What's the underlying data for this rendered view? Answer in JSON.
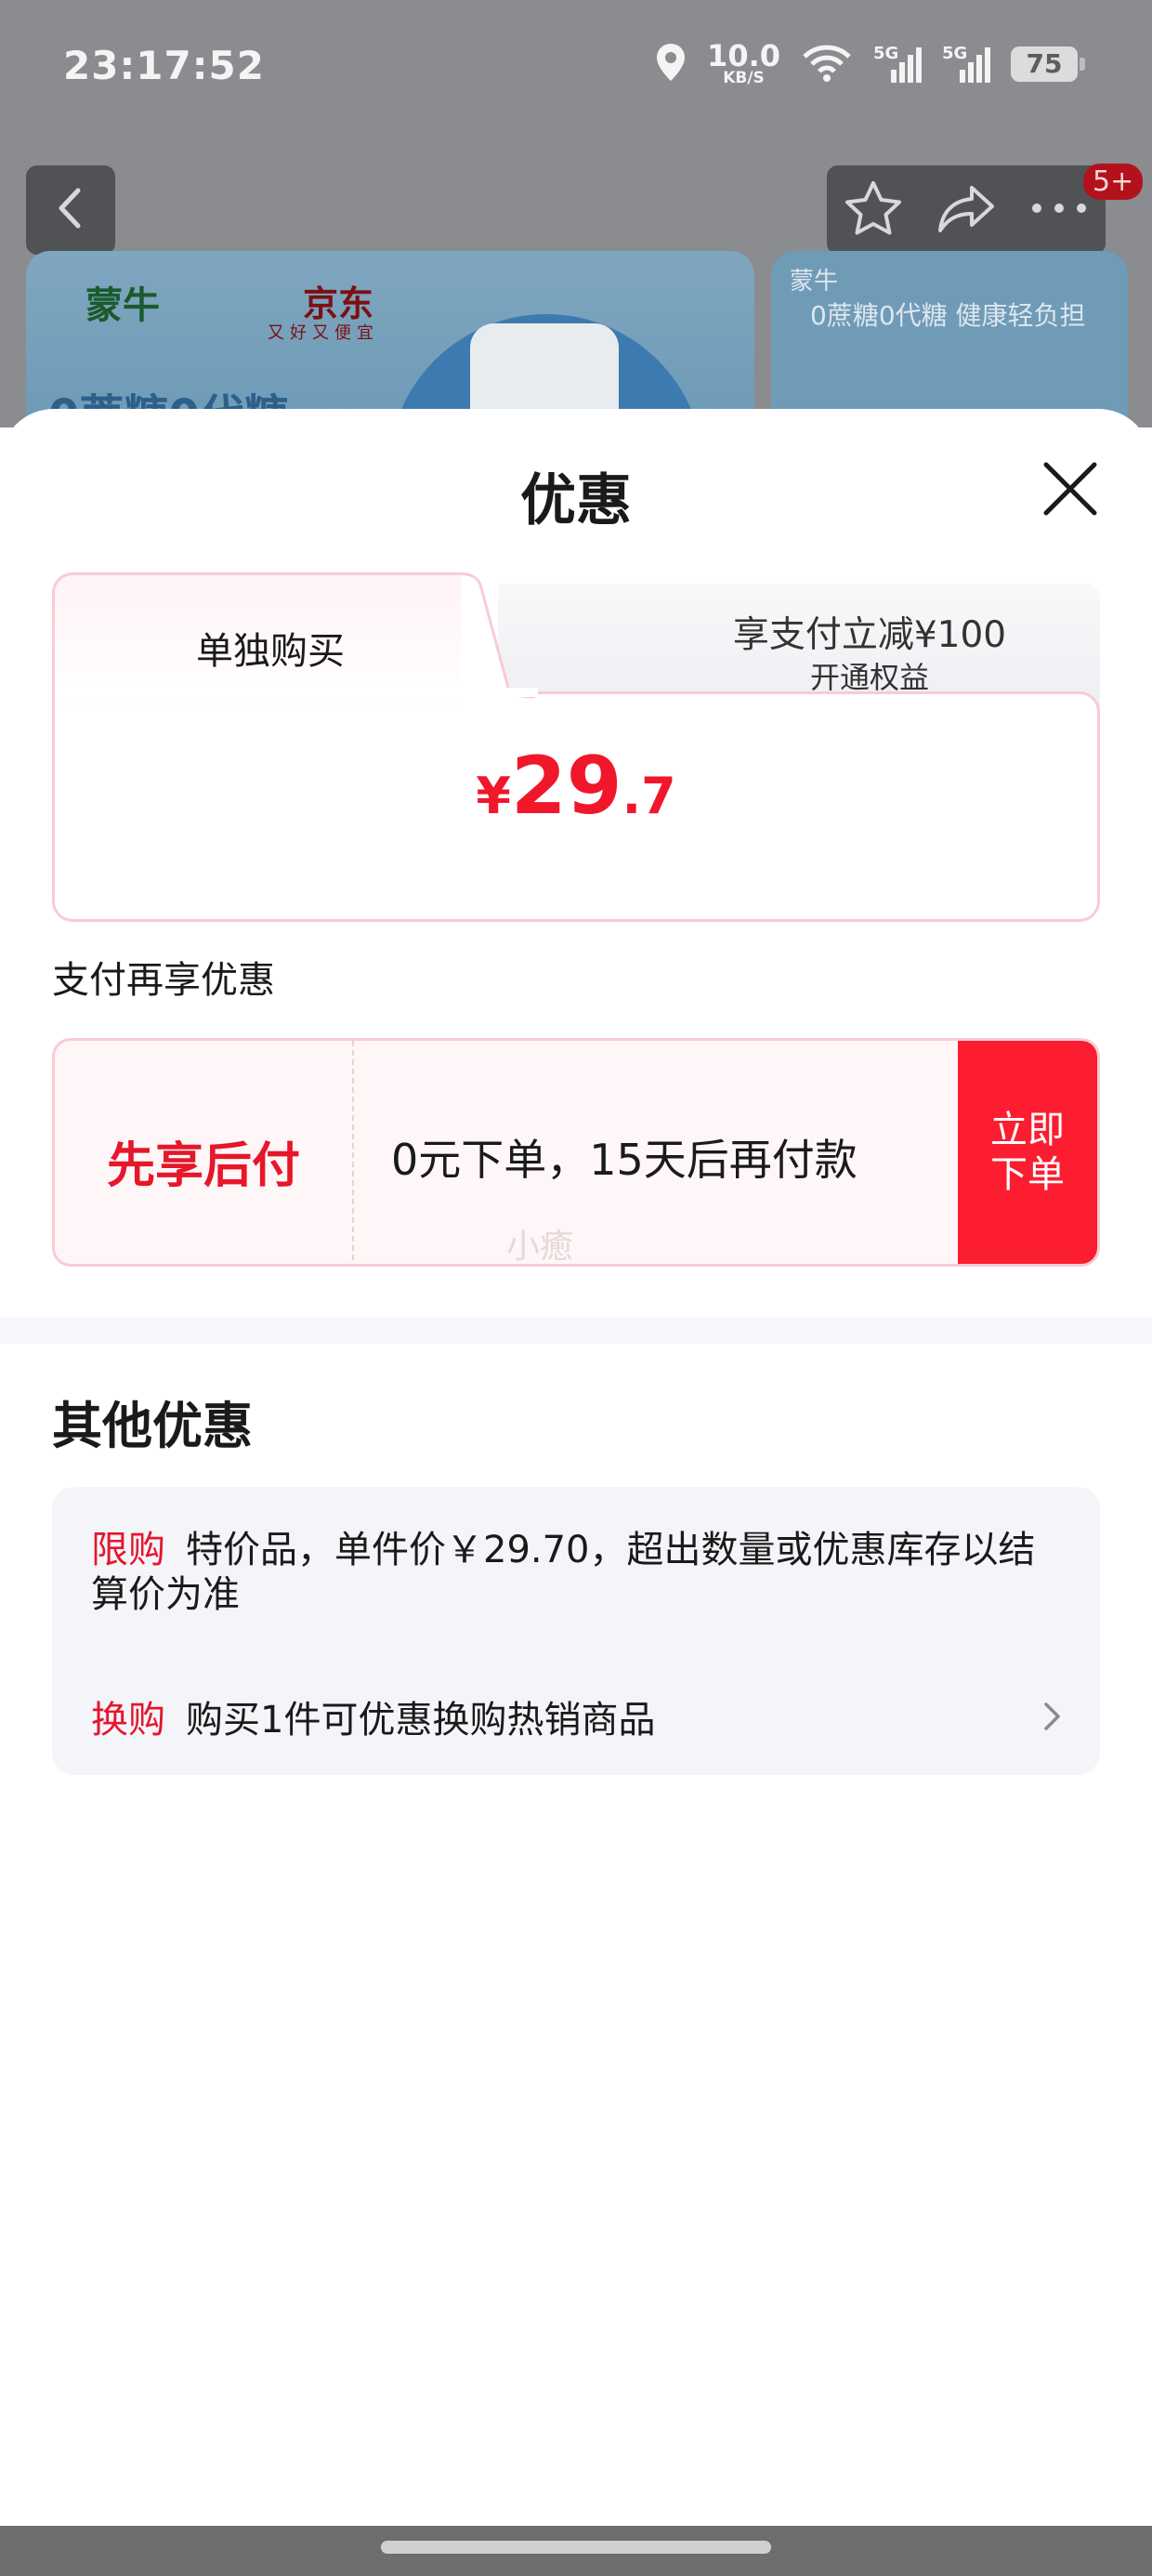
{
  "status_bar": {
    "time": "23:17:52",
    "net_speed_value": "10.0",
    "net_speed_unit": "KB/S",
    "signal1_label": "5G",
    "signal2_label": "5G",
    "battery": "75"
  },
  "background_page": {
    "badge": "5+",
    "banner_brand": "蒙牛",
    "banner_partner": "京东",
    "banner_partner_sub": "又好又便宜",
    "banner_headline": "0蔗糖0代糖",
    "side_brand": "蒙牛",
    "side_text": "0蔗糖0代糖 健康轻负担"
  },
  "sheet": {
    "title": "优惠",
    "tabs": [
      {
        "label": "单独购买"
      },
      {
        "label": "享支付立减¥100",
        "sub": "开通权益"
      }
    ],
    "price": {
      "currency": "¥",
      "integer": "29",
      "decimal": ".7"
    },
    "section_label": "支付再享优惠",
    "pay_later": {
      "title": "先享后付",
      "description": "0元下单，15天后再付款",
      "watermark": "小癒",
      "button_line1": "立即",
      "button_line2": "下单"
    },
    "other": {
      "title": "其他优惠",
      "rules": [
        {
          "tag": "限购",
          "text": "特价品，单件价￥29.70，超出数量或优惠库存以结算价为准"
        },
        {
          "tag": "换购",
          "text": "购买1件可优惠换购热销商品"
        }
      ]
    }
  },
  "colors": {
    "accent_red": "#f0172b",
    "button_red": "#fc1d30",
    "tab_border_pink": "#f8cbd5"
  },
  "icons": [
    "location-icon",
    "wifi-icon",
    "signal-icon",
    "battery-icon",
    "back-icon",
    "star-icon",
    "share-icon",
    "more-icon",
    "close-icon",
    "chevron-right-icon"
  ]
}
